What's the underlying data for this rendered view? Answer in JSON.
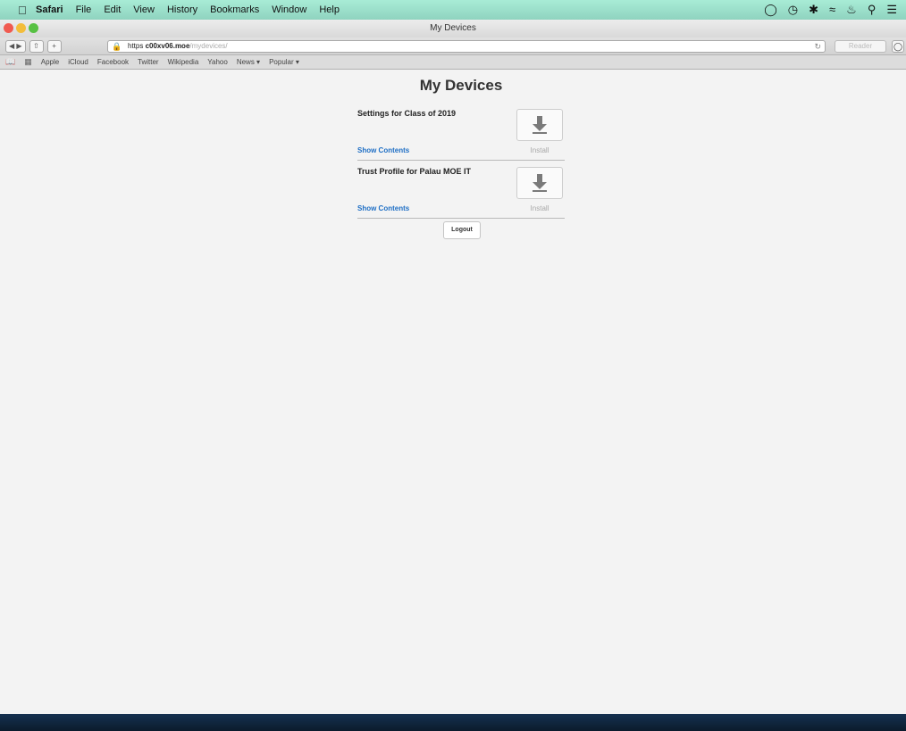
{
  "menubar": {
    "app": "Safari",
    "items": [
      "File",
      "Edit",
      "View",
      "History",
      "Bookmarks",
      "Window",
      "Help"
    ]
  },
  "window": {
    "title": "My Devices"
  },
  "toolbar": {
    "url_scheme": "https",
    "url_host": "c00xv06.moe",
    "url_path": "/mydevices/",
    "reader_label": "Reader"
  },
  "bookmarks": [
    "Apple",
    "iCloud",
    "Facebook",
    "Twitter",
    "Wikipedia",
    "Yahoo",
    "News ▾",
    "Popular ▾"
  ],
  "page": {
    "title": "My Devices",
    "profiles": [
      {
        "name": "Settings for Class of 2019",
        "show_label": "Show Contents",
        "install_label": "Install"
      },
      {
        "name": "Trust Profile for Palau MOE IT",
        "show_label": "Show Contents",
        "install_label": "Install"
      }
    ],
    "logout_label": "Logout"
  },
  "colors": {
    "link": "#1f6fc5",
    "menubar": "#9fd9c8"
  }
}
